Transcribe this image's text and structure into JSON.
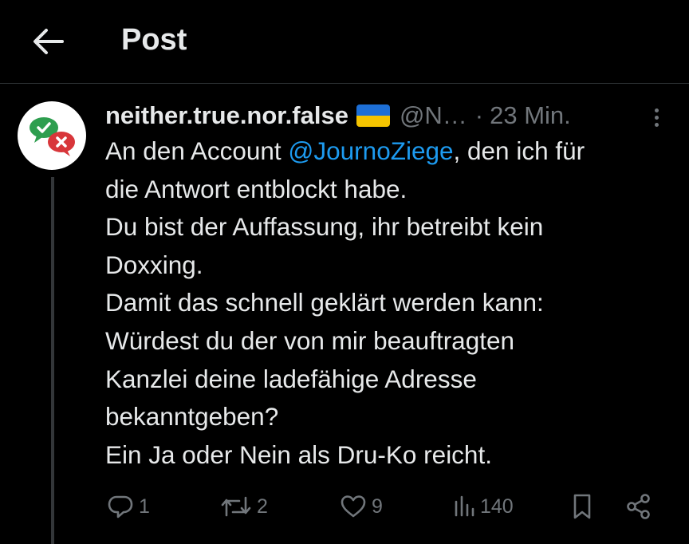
{
  "header": {
    "title": "Post",
    "back_icon": "arrow-left-icon"
  },
  "post": {
    "avatar_icon": "speech-bubbles-check-x-icon",
    "display_name": "neither.true.nor.false",
    "flag_icon": "ukraine-flag-icon",
    "handle": "@N…",
    "separator": "·",
    "time": "23 Min.",
    "more_icon": "more-vertical-icon",
    "text": {
      "line1_before": "An den Account ",
      "mention": "@JournoZiege",
      "line1_after": ", den ich für",
      "line2": "die Antwort entblockt habe.",
      "line3": "Du bist der Auffassung, ihr betreibt kein",
      "line4": "Doxxing.",
      "line5": "Damit das schnell geklärt werden kann:",
      "line6": "Würdest du der von mir beauftragten",
      "line7": "Kanzlei deine ladefähige Adresse",
      "line8": "bekanntgeben?",
      "line9": "Ein Ja oder Nein als Dru-Ko reicht."
    },
    "actions": {
      "replies": "1",
      "reposts": "2",
      "likes": "9",
      "views": "140"
    }
  },
  "colors": {
    "background": "#000000",
    "text": "#e7e9ea",
    "muted": "#71767b",
    "link": "#1d9bf0",
    "divider": "#2f3336"
  }
}
